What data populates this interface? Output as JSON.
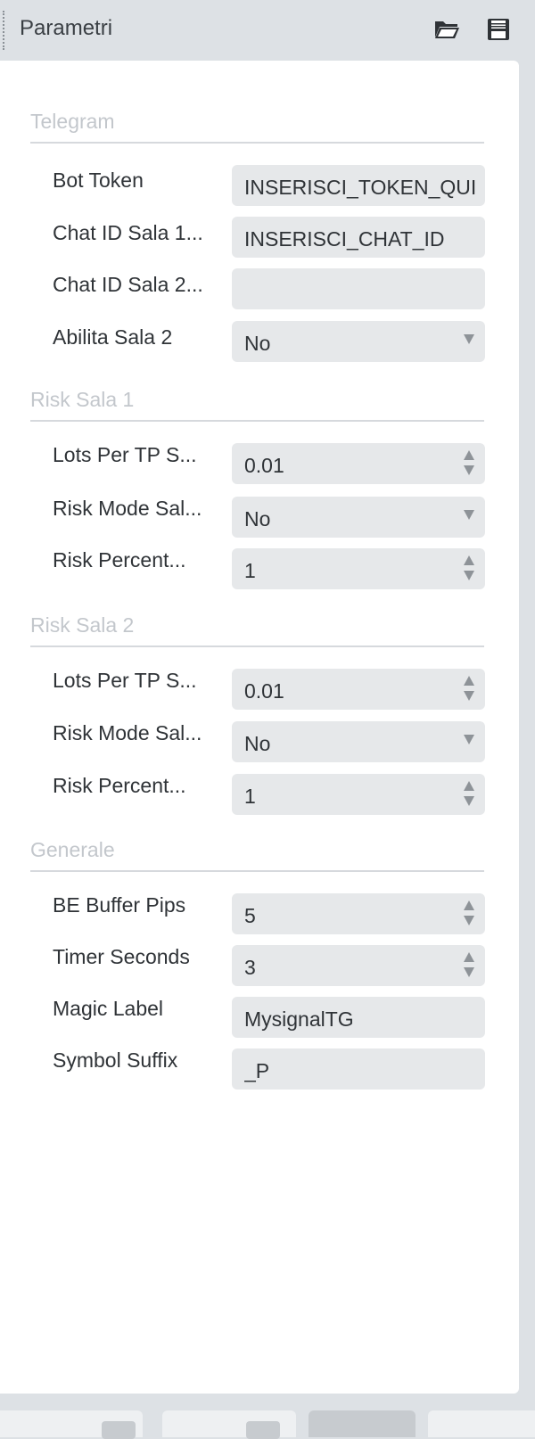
{
  "header": {
    "title": "Parametri",
    "icons": [
      "open-folder-icon",
      "save-icon"
    ]
  },
  "sections": [
    {
      "title": "Telegram",
      "fields": [
        {
          "label": "Bot Token",
          "value": "INSERISCI_TOKEN_QUI",
          "type": "text"
        },
        {
          "label": "Chat ID Sala 1...",
          "value": "INSERISCI_CHAT_ID",
          "type": "text"
        },
        {
          "label": "Chat ID Sala 2...",
          "value": "",
          "type": "text"
        },
        {
          "label": "Abilita Sala 2",
          "value": "No",
          "type": "select"
        }
      ]
    },
    {
      "title": "Risk Sala 1",
      "fields": [
        {
          "label": "Lots Per TP S...",
          "value": "0.01",
          "type": "number"
        },
        {
          "label": "Risk Mode Sal...",
          "value": "No",
          "type": "select"
        },
        {
          "label": "Risk Percent...",
          "value": "1",
          "type": "number"
        }
      ]
    },
    {
      "title": "Risk Sala 2",
      "fields": [
        {
          "label": "Lots Per TP S...",
          "value": "0.01",
          "type": "number"
        },
        {
          "label": "Risk Mode Sal...",
          "value": "No",
          "type": "select"
        },
        {
          "label": "Risk Percent...",
          "value": "1",
          "type": "number"
        }
      ]
    },
    {
      "title": "Generale",
      "fields": [
        {
          "label": "BE Buffer Pips",
          "value": "5",
          "type": "number"
        },
        {
          "label": "Timer Seconds",
          "value": "3",
          "type": "number"
        },
        {
          "label": "Magic Label",
          "value": "MysignalTG",
          "type": "text"
        },
        {
          "label": "Symbol Suffix",
          "value": "_P",
          "type": "text"
        }
      ]
    }
  ],
  "colors": {
    "panel_background": "#dde1e5",
    "body_background": "#ffffff",
    "field_background": "#e6e8ea",
    "section_title": "#c3c7cc",
    "label_text": "#2f3337"
  }
}
